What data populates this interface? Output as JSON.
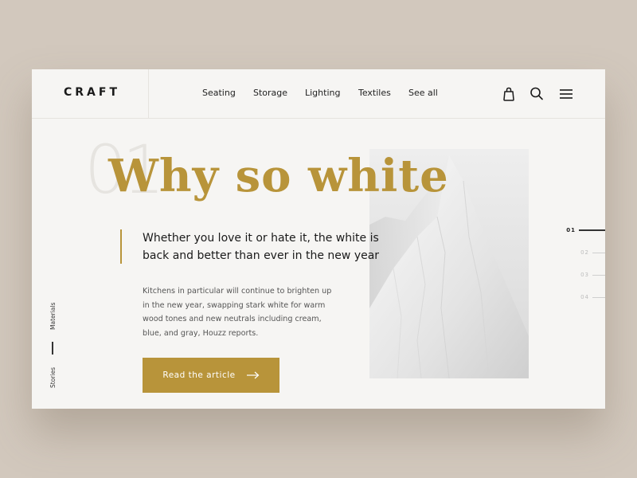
{
  "brand": {
    "logo": "CRAFT",
    "accent_color": "#b8943a",
    "background_color": "#d2c8bd",
    "card_color": "#f6f5f3"
  },
  "nav": {
    "items": [
      {
        "label": "Seating"
      },
      {
        "label": "Storage"
      },
      {
        "label": "Lighting"
      },
      {
        "label": "Textiles"
      },
      {
        "label": "See all"
      }
    ],
    "icons": [
      "shopping-bag-icon",
      "search-icon",
      "hamburger-menu-icon"
    ]
  },
  "hero": {
    "slide_number": "01",
    "headline": "Why so white",
    "quote": "Whether you love it or hate it, the white is back and better than ever in the new year",
    "body": "Kitchens in particular will continue to brighten up in the new year, swapping stark white for warm wood tones and new neutrals including cream, blue, and gray, Houzz reports.",
    "cta_label": "Read the article",
    "image_alt": "White snowy mountain peak"
  },
  "side_nav": {
    "items": [
      {
        "label": "Materials"
      },
      {
        "label": "Stories"
      }
    ]
  },
  "pager": {
    "items": [
      {
        "label": "01",
        "active": true
      },
      {
        "label": "02",
        "active": false
      },
      {
        "label": "03",
        "active": false
      },
      {
        "label": "04",
        "active": false
      }
    ]
  }
}
